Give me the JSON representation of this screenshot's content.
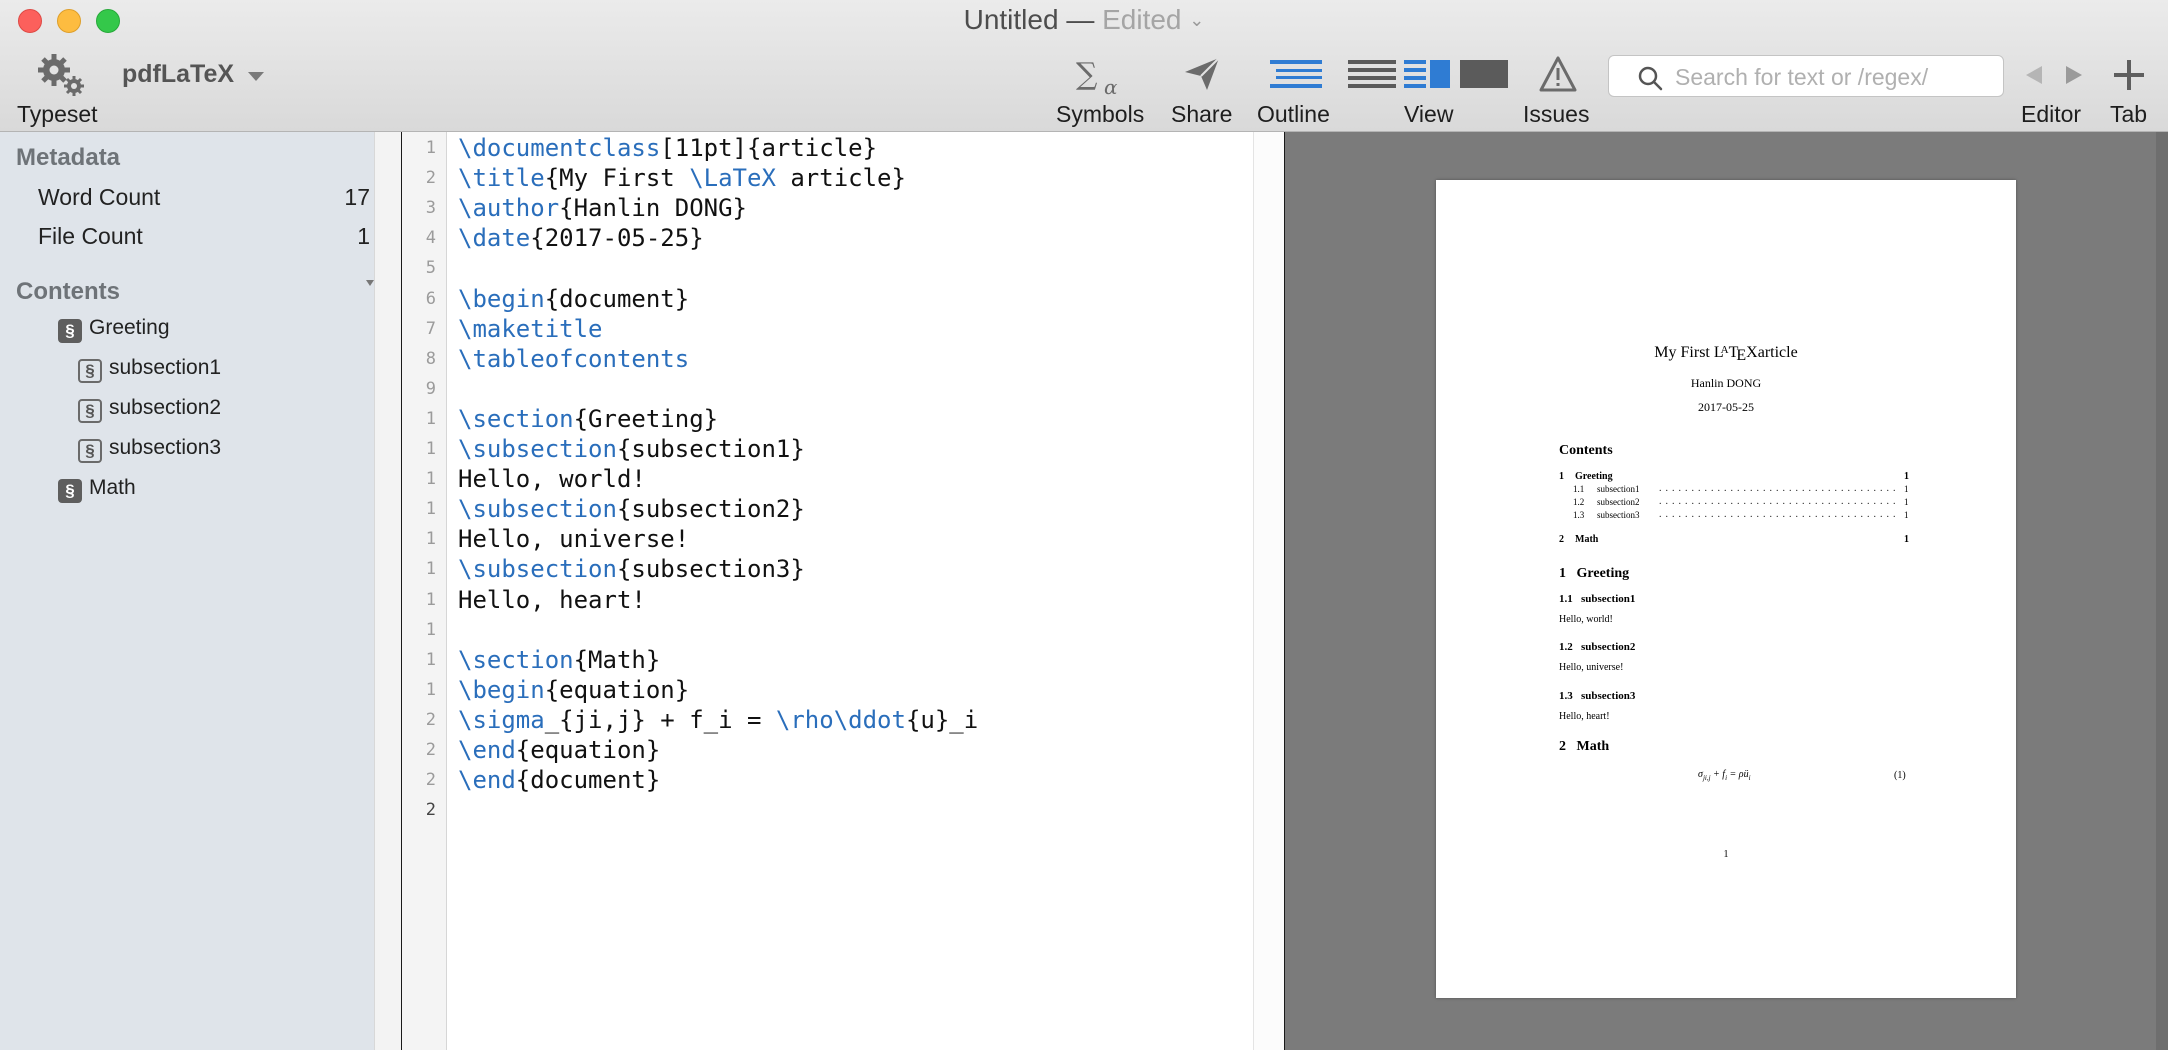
{
  "window": {
    "title": "Untitled",
    "separator": "—",
    "status": "Edited",
    "status_chevron": "⌄"
  },
  "toolbar": {
    "typeset_label": "Typeset",
    "engine": "pdfLaTeX",
    "symbols_label": "Symbols",
    "share_label": "Share",
    "outline_label": "Outline",
    "view_label": "View",
    "issues_label": "Issues",
    "search_placeholder": "Search for text or /regex/",
    "editor_label": "Editor",
    "tab_label": "Tab",
    "accent": "#2f7cd3"
  },
  "sidebar": {
    "metadata_heading": "Metadata",
    "metadata": [
      {
        "label": "Word Count",
        "value": "17"
      },
      {
        "label": "File Count",
        "value": "1"
      }
    ],
    "contents_heading": "Contents",
    "toc": [
      {
        "label": "Greeting",
        "level": 1
      },
      {
        "label": "subsection1",
        "level": 2
      },
      {
        "label": "subsection2",
        "level": 2
      },
      {
        "label": "subsection3",
        "level": 2
      },
      {
        "label": "Math",
        "level": 1
      }
    ],
    "section_glyph": "§"
  },
  "editor": {
    "line_numbers": [
      "1",
      "2",
      "3",
      "4",
      "5",
      "6",
      "7",
      "8",
      "9",
      "1",
      "1",
      "1",
      "1",
      "1",
      "1",
      "1",
      "1",
      "1",
      "1",
      "2",
      "2",
      "2",
      "2"
    ],
    "lines": [
      [
        {
          "t": "\\documentclass",
          "k": 1
        },
        {
          "t": "[11pt]{article}",
          "k": 0
        }
      ],
      [
        {
          "t": "\\title",
          "k": 1
        },
        {
          "t": "{My First ",
          "k": 0
        },
        {
          "t": "\\LaTeX",
          "k": 1
        },
        {
          "t": " article}",
          "k": 0
        }
      ],
      [
        {
          "t": "\\author",
          "k": 1
        },
        {
          "t": "{Hanlin DONG}",
          "k": 0
        }
      ],
      [
        {
          "t": "\\date",
          "k": 1
        },
        {
          "t": "{2017-05-25}",
          "k": 0
        }
      ],
      [],
      [
        {
          "t": "\\begin",
          "k": 1
        },
        {
          "t": "{document}",
          "k": 0
        }
      ],
      [
        {
          "t": "\\maketitle",
          "k": 1
        }
      ],
      [
        {
          "t": "\\tableofcontents",
          "k": 1
        }
      ],
      [],
      [
        {
          "t": "\\section",
          "k": 1
        },
        {
          "t": "{Greeting}",
          "k": 0
        }
      ],
      [
        {
          "t": "\\subsection",
          "k": 1
        },
        {
          "t": "{subsection1}",
          "k": 0
        }
      ],
      [
        {
          "t": "Hello, world!",
          "k": 0
        }
      ],
      [
        {
          "t": "\\subsection",
          "k": 1
        },
        {
          "t": "{subsection2}",
          "k": 0
        }
      ],
      [
        {
          "t": "Hello, universe!",
          "k": 0
        }
      ],
      [
        {
          "t": "\\subsection",
          "k": 1
        },
        {
          "t": "{subsection3}",
          "k": 0
        }
      ],
      [
        {
          "t": "Hello, heart!",
          "k": 0
        }
      ],
      [],
      [
        {
          "t": "\\section",
          "k": 1
        },
        {
          "t": "{Math}",
          "k": 0
        }
      ],
      [
        {
          "t": "\\begin",
          "k": 1
        },
        {
          "t": "{equation}",
          "k": 0
        }
      ],
      [
        {
          "t": "\\sigma",
          "k": 1
        },
        {
          "t": "_{ji,j} + f_i = ",
          "k": 0
        },
        {
          "t": "\\rho\\ddot",
          "k": 1
        },
        {
          "t": "{u}_i",
          "k": 0
        }
      ],
      [
        {
          "t": "\\end",
          "k": 1
        },
        {
          "t": "{equation}",
          "k": 0
        }
      ],
      [
        {
          "t": "\\end",
          "k": 1
        },
        {
          "t": "{document}",
          "k": 0
        }
      ],
      []
    ]
  },
  "preview": {
    "title_pre": "My First ",
    "title_post": "article",
    "author": "Hanlin DONG",
    "date": "2017-05-25",
    "contents_heading": "Contents",
    "toc": [
      {
        "num": "1",
        "title": "Greeting",
        "page": "1",
        "bold": true
      },
      {
        "num": "1.1",
        "title": "subsection1",
        "page": "1",
        "bold": false
      },
      {
        "num": "1.2",
        "title": "subsection2",
        "page": "1",
        "bold": false
      },
      {
        "num": "1.3",
        "title": "subsection3",
        "page": "1",
        "bold": false
      },
      {
        "num": "2",
        "title": "Math",
        "page": "1",
        "bold": true
      }
    ],
    "sections": [
      {
        "num": "1",
        "title": "Greeting"
      },
      {
        "num": "1.1",
        "title": "subsection1",
        "body": "Hello, world!"
      },
      {
        "num": "1.2",
        "title": "subsection2",
        "body": "Hello, universe!"
      },
      {
        "num": "1.3",
        "title": "subsection3",
        "body": "Hello, heart!"
      },
      {
        "num": "2",
        "title": "Math"
      }
    ],
    "equation_number": "(1)",
    "page_number": "1"
  }
}
